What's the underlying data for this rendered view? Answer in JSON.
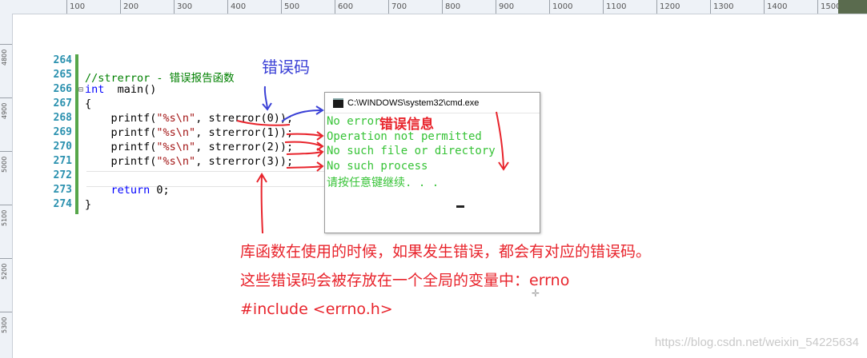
{
  "ruler": {
    "top_labels": [
      "100",
      "200",
      "300",
      "400",
      "500",
      "600",
      "700",
      "800",
      "900",
      "1000",
      "1100",
      "1200",
      "1300",
      "1400",
      "1500"
    ],
    "left_labels": [
      "4800",
      "4900",
      "5000",
      "5100",
      "5200",
      "5300"
    ]
  },
  "editor": {
    "line_numbers": [
      "264",
      "265",
      "266",
      "267",
      "268",
      "269",
      "270",
      "271",
      "272",
      "273",
      "274"
    ],
    "collapse_icon": "minus-box-icon",
    "lines": {
      "l264": "",
      "l265": "//strerror - 错误报告函数",
      "l266_kw": "int",
      "l266_rest": "  main()",
      "l267": "{",
      "l268_a": "    printf(",
      "l268_s": "\"%s\\n\"",
      "l268_b": ", strerror(0));",
      "l269_a": "    printf(",
      "l269_s": "\"%s\\n\"",
      "l269_b": ", strerror(1));",
      "l270_a": "    printf(",
      "l270_s": "\"%s\\n\"",
      "l270_b": ", strerror(2));",
      "l271_a": "    printf(",
      "l271_s": "\"%s\\n\"",
      "l271_b": ", strerror(3));",
      "l272": "",
      "l273_a": "    ",
      "l273_kw": "return",
      "l273_b": " 0;",
      "l274": "}"
    }
  },
  "cmd": {
    "title": "C:\\WINDOWS\\system32\\cmd.exe",
    "output": [
      "No error",
      "Operation not permitted",
      "No such file or directory",
      "No such process",
      "请按任意键继续. . ."
    ]
  },
  "annotations": {
    "error_code_label": "错误码",
    "error_info_label": "错误信息",
    "notes": [
      "库函数在使用的时候，如果发生错误，都会有对应的错误码。",
      "这些错误码会被存放在一个全局的变量中：errno",
      "#include <errno.h>"
    ]
  },
  "watermark": "https://blog.csdn.net/weixin_54225634",
  "colors": {
    "annotation_red": "#e8242c",
    "annotation_blue": "#3a40d6",
    "console_green": "#37c337",
    "gutter_green": "#57a64a"
  }
}
